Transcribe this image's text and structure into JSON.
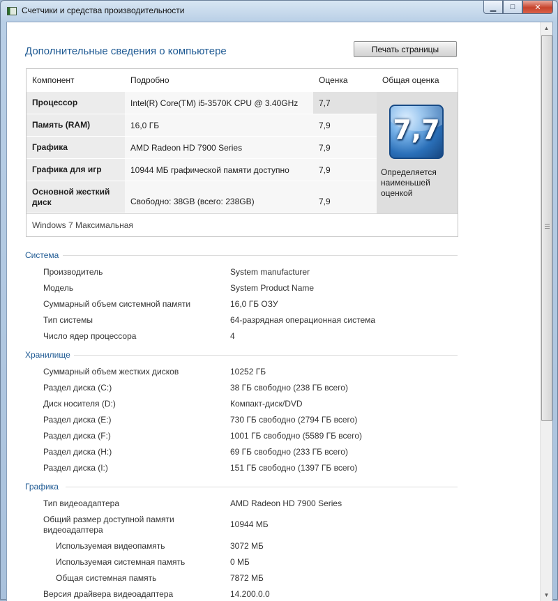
{
  "window": {
    "title": "Счетчики и средства производительности",
    "buttons": {
      "minimize": "▁",
      "maximize": "□",
      "close": "✕"
    }
  },
  "page": {
    "title": "Дополнительные сведения о компьютере",
    "print_button": "Печать страницы"
  },
  "scores": {
    "headers": {
      "component": "Компонент",
      "details": "Подробно",
      "rating": "Оценка",
      "overall": "Общая оценка"
    },
    "rows": [
      {
        "component": "Процессор",
        "details": "Intel(R) Core(TM) i5-3570K CPU @ 3.40GHz",
        "rating": "7,7"
      },
      {
        "component": "Память (RAM)",
        "details": "16,0 ГБ",
        "rating": "7,9"
      },
      {
        "component": "Графика",
        "details": "AMD Radeon HD 7900 Series",
        "rating": "7,9"
      },
      {
        "component": "Графика для игр",
        "details": "10944 МБ графической памяти доступно",
        "rating": "7,9"
      },
      {
        "component": "Основной жесткий диск",
        "details": "Свободно: 38GB (всего: 238GB)",
        "rating": "7,9"
      }
    ],
    "overall": {
      "value": "7,7",
      "caption_lines": [
        "Определяется",
        "наименьшей",
        "оценкой"
      ]
    },
    "os_edition": "Windows 7 Максимальная"
  },
  "sections": {
    "system": {
      "title": "Система",
      "items": [
        {
          "label": "Производитель",
          "value": "System manufacturer"
        },
        {
          "label": "Модель",
          "value": "System Product Name"
        },
        {
          "label": "Суммарный объем системной памяти",
          "value": "16,0 ГБ ОЗУ"
        },
        {
          "label": "Тип системы",
          "value": "64-разрядная операционная система"
        },
        {
          "label": "Число ядер процессора",
          "value": "4"
        }
      ]
    },
    "storage": {
      "title": "Хранилище",
      "items": [
        {
          "label": "Суммарный объем жестких дисков",
          "value": "10252 ГБ"
        },
        {
          "label": "Раздел диска (C:)",
          "value": "38 ГБ свободно (238 ГБ всего)"
        },
        {
          "label": "Диск носителя (D:)",
          "value": "Компакт-диск/DVD"
        },
        {
          "label": "Раздел диска (E:)",
          "value": "730 ГБ свободно (2794 ГБ всего)"
        },
        {
          "label": "Раздел диска (F:)",
          "value": "1001 ГБ свободно (5589 ГБ всего)"
        },
        {
          "label": "Раздел диска (H:)",
          "value": "69 ГБ свободно (233 ГБ всего)"
        },
        {
          "label": "Раздел диска (I:)",
          "value": "151 ГБ свободно (1397 ГБ всего)"
        }
      ]
    },
    "graphics": {
      "title": "Графика",
      "items": [
        {
          "label": "Тип видеоадаптера",
          "value": "AMD Radeon HD 7900 Series"
        },
        {
          "label_lines": [
            "Общий размер доступной памяти",
            "видеоадаптера"
          ],
          "value": "10944 МБ"
        },
        {
          "label": "Используемая видеопамять",
          "value": "3072 МБ"
        },
        {
          "label": "Используемая системная память",
          "value": "0 МБ"
        },
        {
          "label": "Общая системная память",
          "value": "7872 МБ"
        },
        {
          "label": "Версия драйвера видеоадаптера",
          "value": "14.200.0.0"
        }
      ]
    }
  },
  "icons": {
    "app": "performance-meter-icon",
    "scroll_up": "▲",
    "scroll_down": "▼"
  }
}
